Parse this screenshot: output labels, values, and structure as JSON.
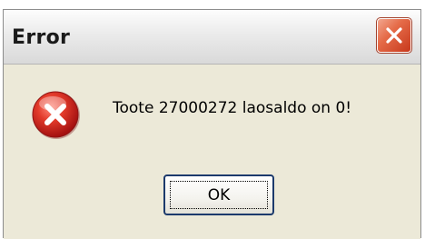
{
  "window": {
    "title": "Error"
  },
  "dialog": {
    "icon": "error-icon",
    "message": "Toote 27000272 laosaldo on 0!",
    "ok_label": "OK"
  },
  "colors": {
    "close_button": "#e56b48",
    "error_icon": "#c81f1f",
    "dialog_background": "#ece9d8"
  }
}
